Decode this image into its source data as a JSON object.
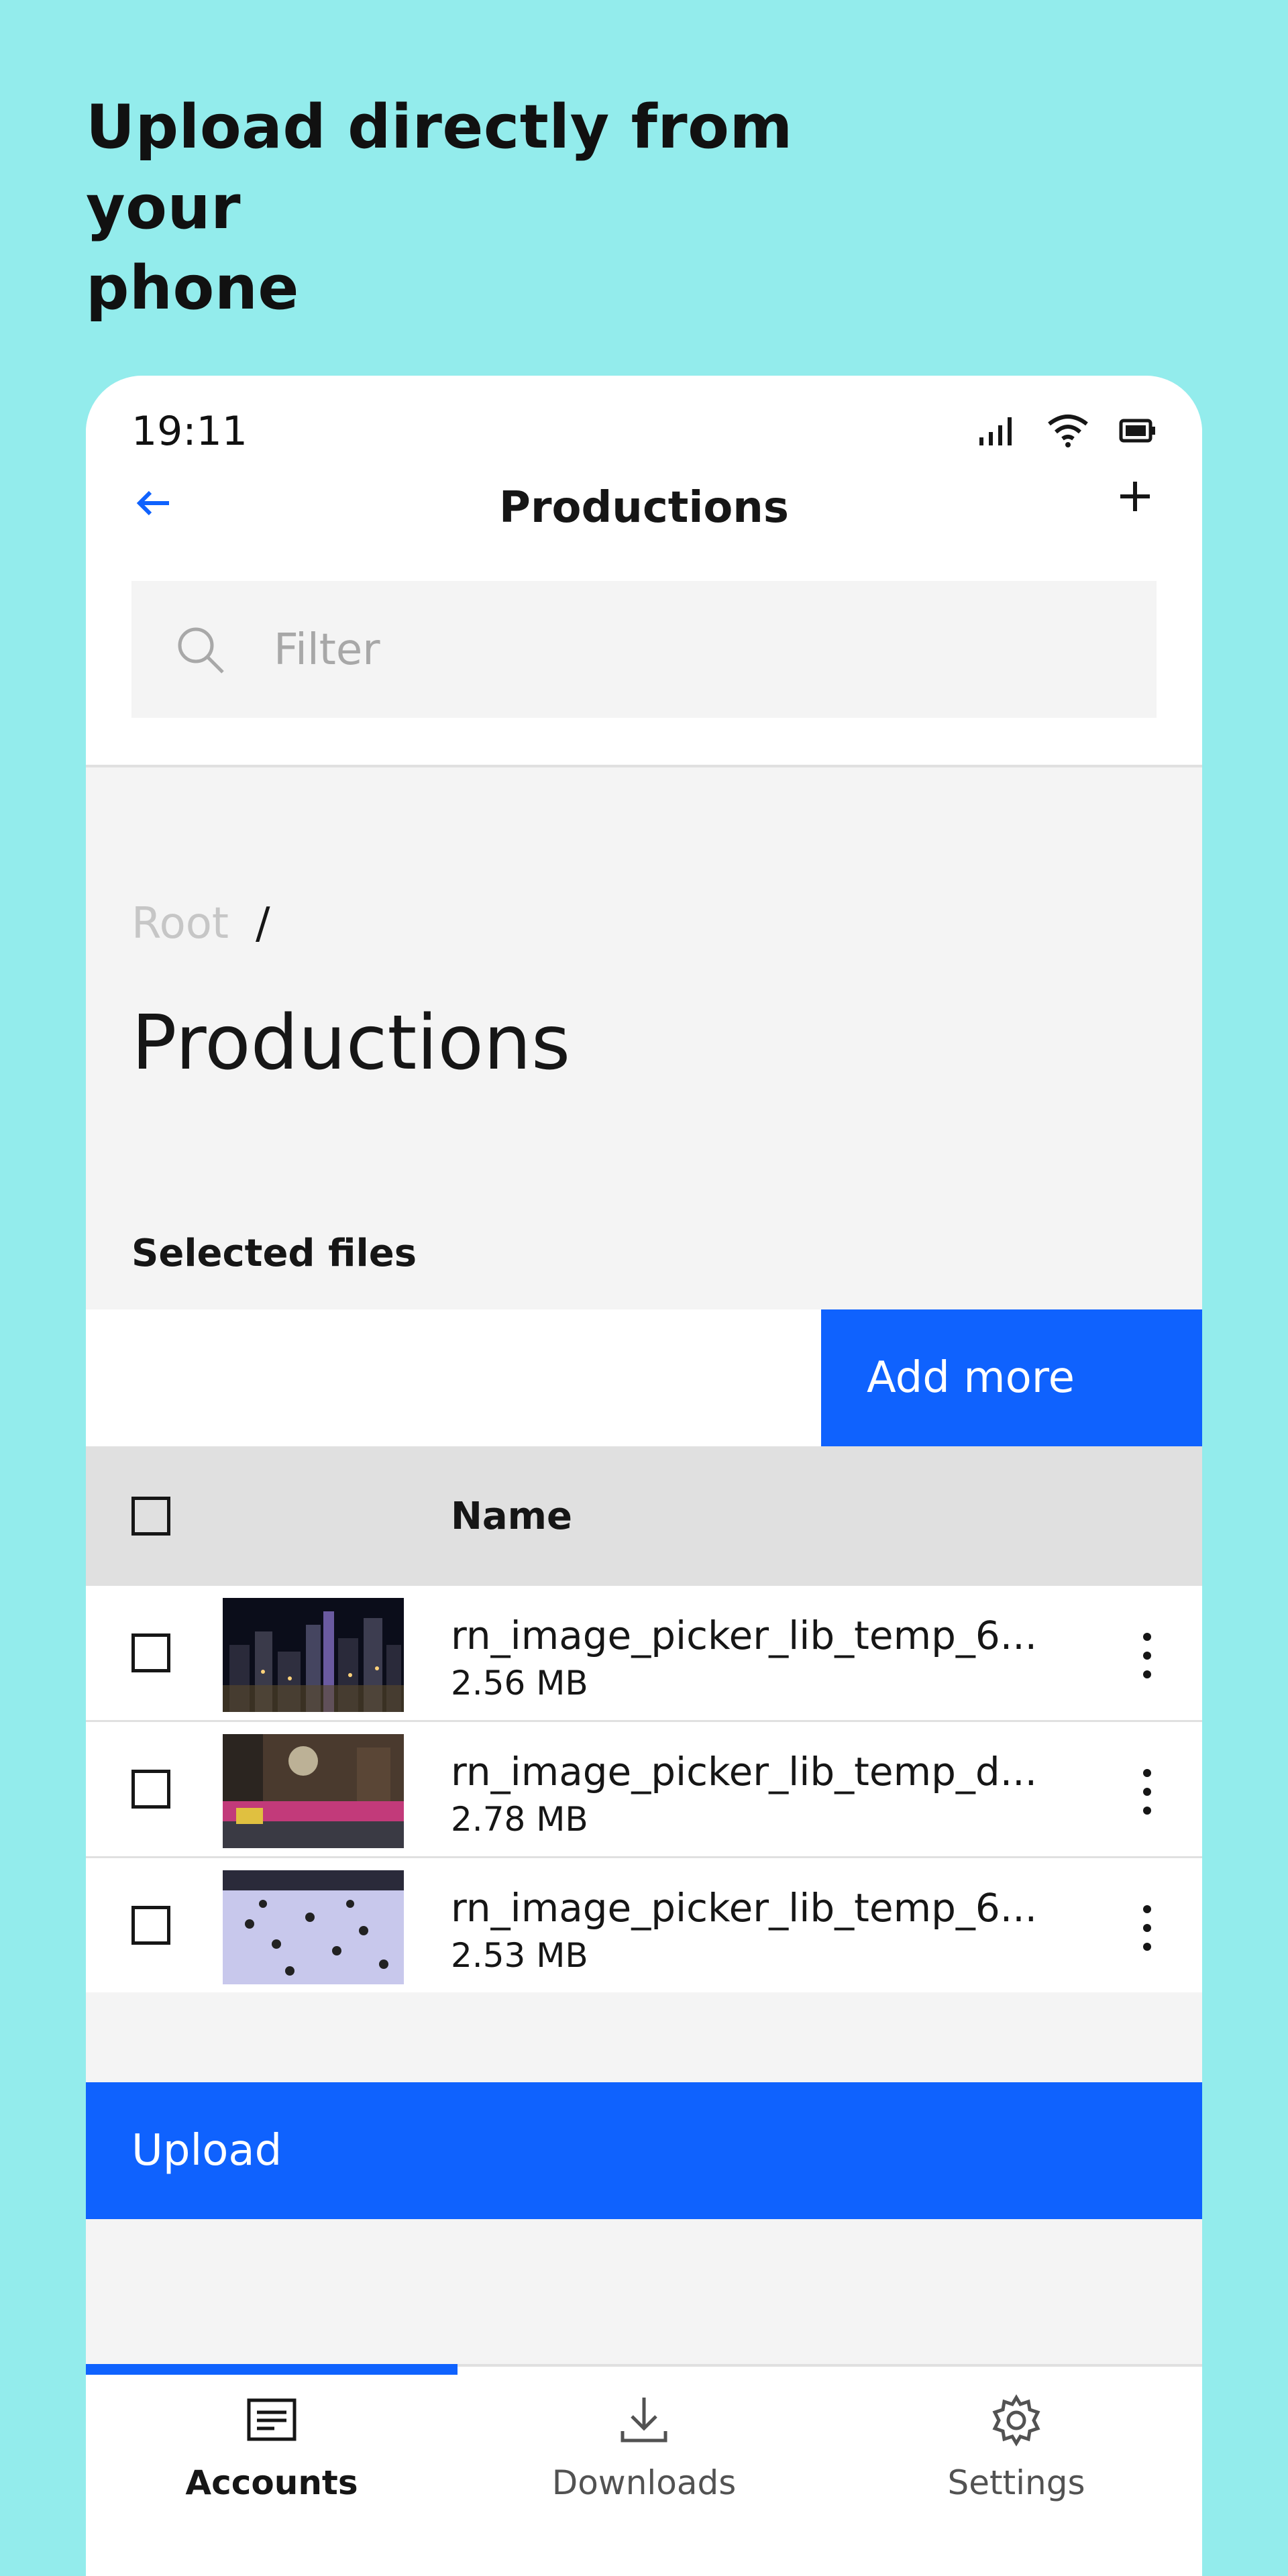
{
  "promo": {
    "headline": "Upload directly from your\nphone"
  },
  "status_bar": {
    "time": "19:11",
    "icons": [
      "signal-icon",
      "wifi-icon",
      "battery-icon"
    ]
  },
  "nav": {
    "title": "Productions",
    "back_icon": "arrow-left-icon",
    "add_icon": "plus-icon"
  },
  "search": {
    "placeholder": "Filter",
    "value": ""
  },
  "breadcrumb": {
    "root": "Root",
    "separator": "/"
  },
  "page": {
    "title": "Productions",
    "section_label": "Selected files",
    "add_more_label": "Add more"
  },
  "table": {
    "header_name": "Name",
    "rows": [
      {
        "name": "rn_image_picker_lib_temp_6...",
        "size": "2.56 MB",
        "thumbnail": "city-night-skyline"
      },
      {
        "name": "rn_image_picker_lib_temp_d...",
        "size": "2.78 MB",
        "thumbnail": "street-night-lights"
      },
      {
        "name": "rn_image_picker_lib_temp_6...",
        "size": "2.53 MB",
        "thumbnail": "ice-rink-skaters"
      }
    ]
  },
  "upload": {
    "label": "Upload"
  },
  "tabs": [
    {
      "label": "Accounts",
      "icon": "accounts-icon",
      "active": true
    },
    {
      "label": "Downloads",
      "icon": "download-icon",
      "active": false
    },
    {
      "label": "Settings",
      "icon": "gear-icon",
      "active": false
    }
  ],
  "colors": {
    "background": "#93ecec",
    "accent": "#0f62fe",
    "surface": "#f4f4f4"
  }
}
